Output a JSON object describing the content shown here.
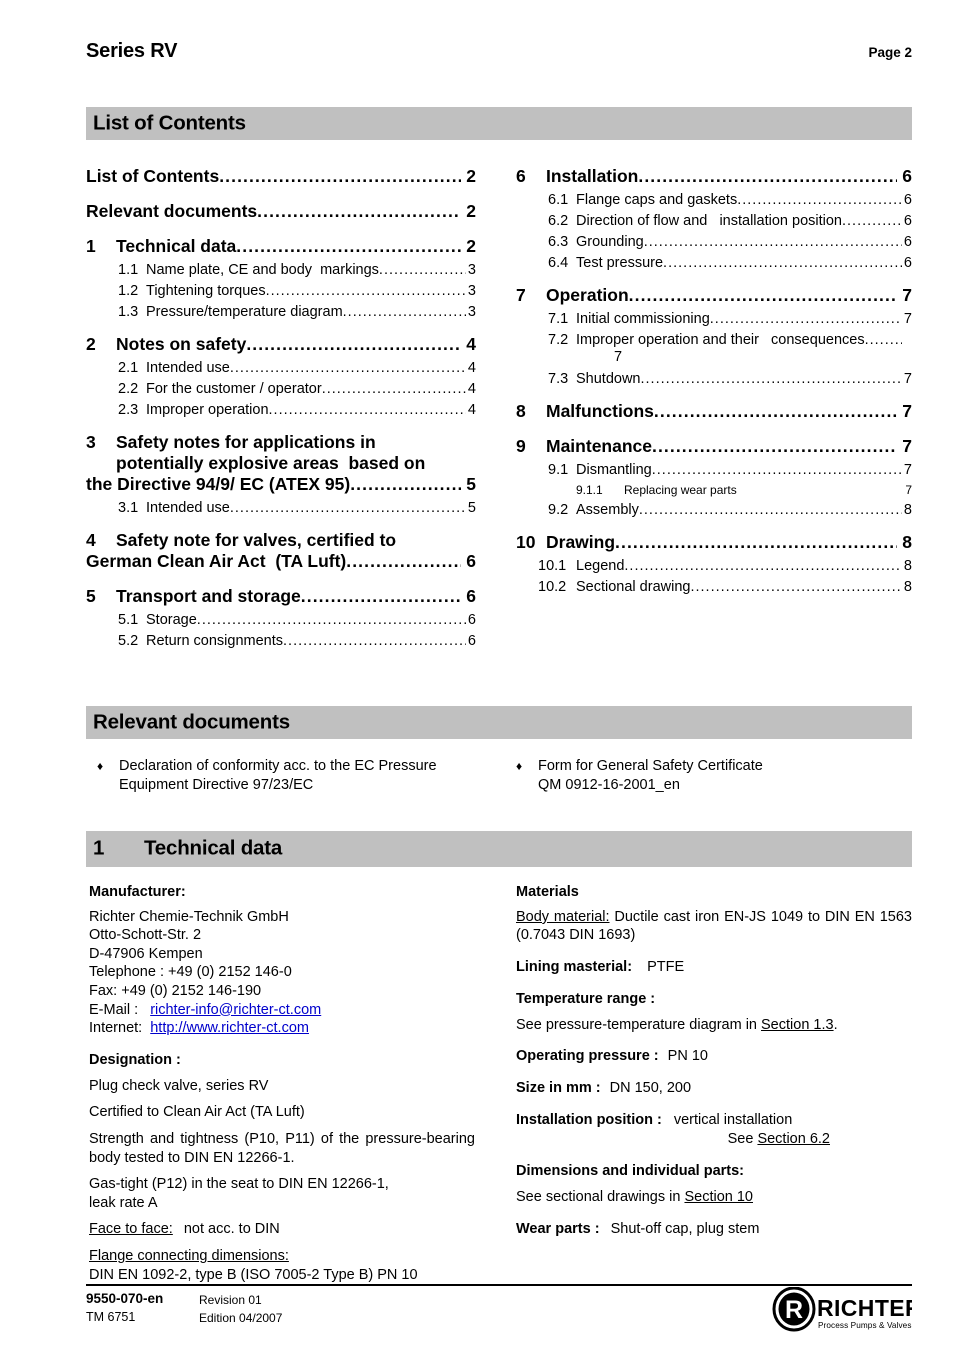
{
  "header": {
    "series_title": "Series RV",
    "page_label": "Page 2"
  },
  "sections": {
    "contents_bar": "List of Contents",
    "relevant_bar": "Relevant documents",
    "technical_bar_num": "1",
    "technical_bar_label": "Technical data"
  },
  "toc": {
    "left": [
      {
        "level": 1,
        "num": "",
        "text": "List of Contents",
        "page": "2"
      },
      {
        "level": 1,
        "num": "",
        "text": "Relevant documents",
        "page": "2"
      },
      {
        "level": 1,
        "num": "1",
        "text": "Technical data",
        "page": "2"
      },
      {
        "level": 2,
        "num": "1.1",
        "text": "Name plate, CE and body  markings",
        "page": "3"
      },
      {
        "level": 2,
        "num": "1.2",
        "text": "Tightening torques",
        "page": "3"
      },
      {
        "level": 2,
        "num": "1.3",
        "text": "Pressure/temperature diagram",
        "page": "3"
      },
      {
        "level": 1,
        "num": "2",
        "text": "Notes on safety",
        "page": "4"
      },
      {
        "level": 2,
        "num": "2.1",
        "text": "Intended use",
        "page": "4"
      },
      {
        "level": 2,
        "num": "2.2",
        "text": "For the customer / operator",
        "page": "4"
      },
      {
        "level": 2,
        "num": "2.3",
        "text": "Improper operation",
        "page": "4"
      },
      {
        "level": 1,
        "num": "3",
        "line1": "Safety notes for applications in",
        "line2": "potentially explosive areas  based on",
        "text": "the Directive 94/9/ EC (ATEX 95)",
        "page": "5"
      },
      {
        "level": 2,
        "num": "3.1",
        "text": "Intended use",
        "page": "5"
      },
      {
        "level": 1,
        "num": "4",
        "line1": "Safety note for valves, certified to",
        "text": "German Clean Air Act  (TA Luft)",
        "page": "6"
      },
      {
        "level": 1,
        "num": "5",
        "text": "Transport and storage",
        "page": "6"
      },
      {
        "level": 2,
        "num": "5.1",
        "text": "Storage",
        "page": "6"
      },
      {
        "level": 2,
        "num": "5.2",
        "text": "Return consignments",
        "page": "6"
      }
    ],
    "right": [
      {
        "level": 1,
        "num": "6",
        "text": "Installation",
        "page": "6"
      },
      {
        "level": 2,
        "num": "6.1",
        "text": "Flange caps and gaskets",
        "page": "6"
      },
      {
        "level": 2,
        "num": "6.2",
        "text": "Direction of flow and   installation position",
        "page": "6"
      },
      {
        "level": 2,
        "num": "6.3",
        "text": "Grounding",
        "page": "6"
      },
      {
        "level": 2,
        "num": "6.4",
        "text": "Test pressure",
        "page": "6"
      },
      {
        "level": 1,
        "num": "7",
        "text": "Operation",
        "page": "7"
      },
      {
        "level": 2,
        "num": "7.1",
        "text": "Initial commissioning",
        "page": "7"
      },
      {
        "level": 2,
        "num": "7.2",
        "text": "Improper operation and their   consequences",
        "page": "7",
        "overflow_page": true
      },
      {
        "level": 2,
        "num": "7.3",
        "text": "Shutdown",
        "page": "7"
      },
      {
        "level": 1,
        "num": "8",
        "text": "Malfunctions",
        "page": "7"
      },
      {
        "level": 1,
        "num": "9",
        "text": "Maintenance",
        "page": "7"
      },
      {
        "level": 2,
        "num": "9.1",
        "text": "Dismantling",
        "page": "7"
      },
      {
        "level": 3,
        "num": "9.1.1",
        "text": "Replacing wear parts",
        "page": "7",
        "no_dots": true
      },
      {
        "level": 2,
        "num": "9.2",
        "text": "Assembly",
        "page": "8"
      },
      {
        "level": 1,
        "num": "10",
        "text": "Drawing",
        "page": "8"
      },
      {
        "level": 2,
        "num": "10.1",
        "text": "Legend",
        "page": "8",
        "wide": true
      },
      {
        "level": 2,
        "num": "10.2",
        "text": "Sectional drawing",
        "page": "8",
        "wide": true
      }
    ]
  },
  "relevant_documents": {
    "bullet_glyph": "♦",
    "left": {
      "line1": "Declaration of conformity acc. to the EC Pressure",
      "line2": "Equipment Directive 97/23/EC"
    },
    "right": {
      "line1": "Form for General Safety Certificate",
      "line2": "QM 0912-16-2001_en"
    }
  },
  "technical_data": {
    "manufacturer": {
      "heading": "Manufacturer:",
      "company": "Richter Chemie-Technik GmbH",
      "street": "Otto-Schott-Str. 2",
      "city": "D-47906 Kempen",
      "telephone": "Telephone : +49 (0) 2152 146-0",
      "fax": "Fax: +49 (0) 2152 146-190",
      "email_label": "E-Mail :",
      "email_value": "richter-info@richter-ct.com",
      "internet_label": "Internet:",
      "internet_value": "http://www.richter-ct.com"
    },
    "designation": {
      "heading": "Designation :",
      "line1": "Plug check valve, series RV",
      "line2": "Certified to Clean Air Act (TA Luft)",
      "para": "Strength and tightness (P10, P11) of the pressure-bearing body tested to DIN EN 12266-1.",
      "gastight_1": "Gas-tight (P12) in the seat  to DIN EN 12266-1,",
      "gastight_2": "leak rate A",
      "face_label": "Face to face:",
      "face_value": "not acc. to DIN",
      "flange_label": "Flange connecting dimensions:",
      "flange_value": "DIN EN 1092-2, type B (ISO 7005-2 Type B) PN 10"
    },
    "materials": {
      "heading": "Materials",
      "body_label": "Body material:",
      "body_value": "Ductile cast iron EN-JS 1049 to DIN EN 1563 (0.7043 DIN 1693)",
      "lining_label": "Lining masterial:",
      "lining_value": "PTFE",
      "temp_label": "Temperature range :",
      "temp_value_pre": "See pressure-temperature diagram in ",
      "temp_value_link": "Section 1.3",
      "temp_value_post": ".",
      "pressure_label": "Operating pressure :",
      "pressure_value": "PN 10",
      "size_label": "Size in mm :",
      "size_value": "DN 150, 200",
      "install_label": "Installation position :",
      "install_value_1": "vertical installation",
      "install_value_2_pre": "See ",
      "install_value_2_link": "Section 6.2",
      "dims_label": "Dimensions and individual parts:",
      "dims_value_pre": "See sectional drawings in ",
      "dims_value_link": "Section 10",
      "wear_label": "Wear parts :",
      "wear_value": "Shut-off cap, plug stem"
    }
  },
  "footer": {
    "doc_number": "9550-070-en",
    "tm_number": "TM 6751",
    "revision": "Revision 01",
    "edition": "Edition 04/2007",
    "logo_name": "RICHTER",
    "logo_tagline": "Process Pumps & Valves",
    "logo_monogram": "R"
  },
  "colors": {
    "section_bar": "#c0c0c0",
    "link": "#0000cc",
    "text": "#000000"
  }
}
